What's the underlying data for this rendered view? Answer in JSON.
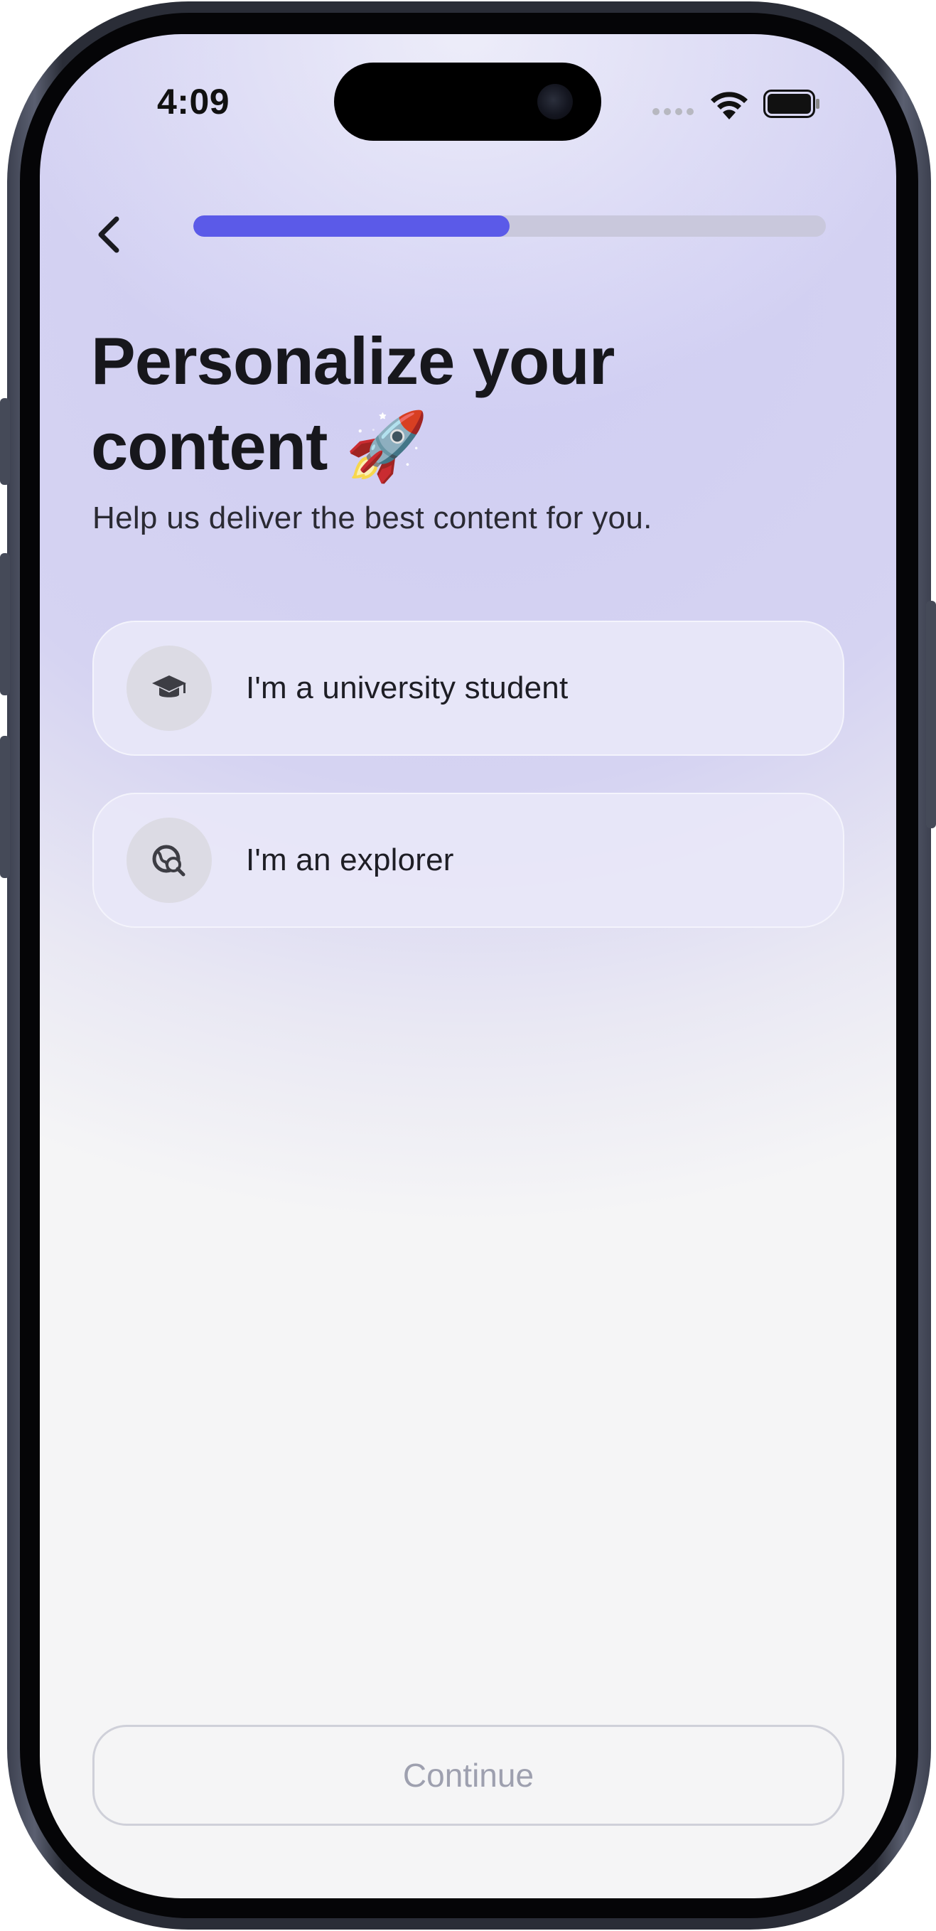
{
  "status_bar": {
    "time": "4:09",
    "icons": [
      "signal-dots-icon",
      "wifi-icon",
      "battery-icon"
    ]
  },
  "nav": {
    "back_icon": "chevron-left-icon",
    "progress": 0.5
  },
  "header": {
    "title": "Personalize your content",
    "title_emoji": "🚀",
    "subtitle": "Help us deliver the best content for you."
  },
  "options": [
    {
      "label": "I'm a university student",
      "icon": "graduation-cap-icon"
    },
    {
      "label": "I'm an explorer",
      "icon": "globe-search-icon"
    }
  ],
  "footer": {
    "continue_label": "Continue"
  },
  "colors": {
    "accent": "#5b5ae8",
    "progress_track": "#c9c8dc",
    "card_bg": "#e8e7f9",
    "disabled_text": "#9ea0af"
  }
}
